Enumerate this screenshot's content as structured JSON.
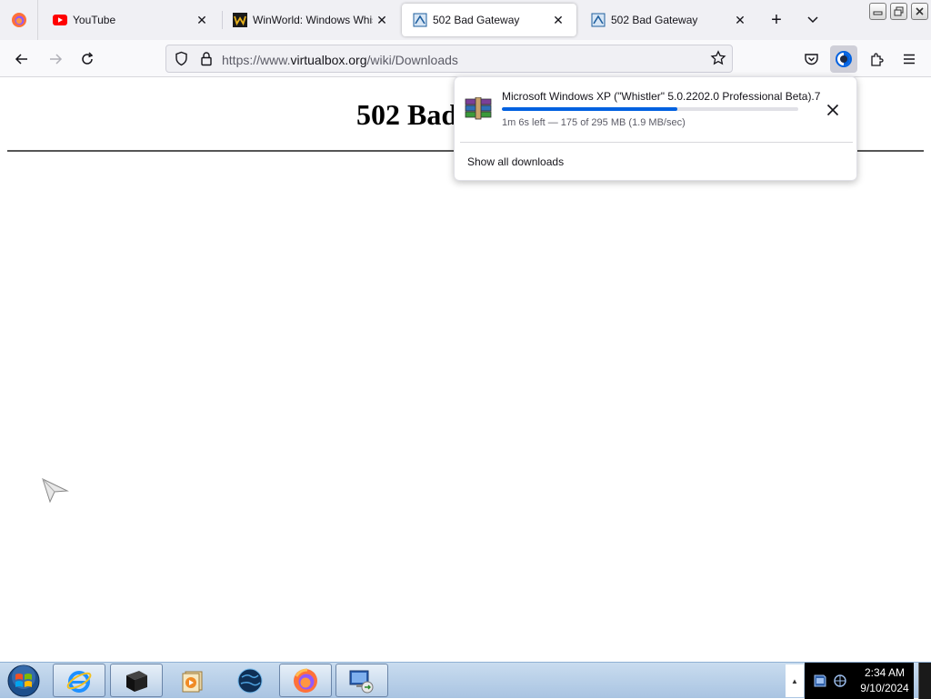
{
  "browser": {
    "tabs": [
      {
        "title": "YouTube",
        "favicon": "youtube-icon",
        "active": false
      },
      {
        "title": "WinWorld: Windows Whistler",
        "favicon": "winworld-icon",
        "active": false
      },
      {
        "title": "502 Bad Gateway",
        "favicon": "virtualbox-icon",
        "active": true
      },
      {
        "title": "502 Bad Gateway",
        "favicon": "virtualbox-icon",
        "active": false
      }
    ],
    "url_prefix": "https://www.",
    "url_host": "virtualbox.org",
    "url_path": "/wiki/Downloads"
  },
  "page": {
    "heading": "502 Bad Gateway"
  },
  "downloads": {
    "item_name": "Microsoft Windows XP (\"Whistler\" 5.0.2202.0 Professional Beta).7z",
    "status": "1m 6s left — 175 of 295 MB (1.9 MB/sec)",
    "progress": 0.593,
    "show_all_label": "Show all downloads"
  },
  "taskbar": {
    "items": [
      "internet-explorer-icon",
      "terminal-icon",
      "media-player-icon",
      "globe-icon",
      "firefox-icon",
      "remote-desktop-icon"
    ],
    "time": "2:34 AM",
    "date": "9/10/2024"
  },
  "colors": {
    "accent": "#0061e0",
    "tab_strip": "#f0f0f4",
    "taskbar": "#b8d0e8"
  }
}
